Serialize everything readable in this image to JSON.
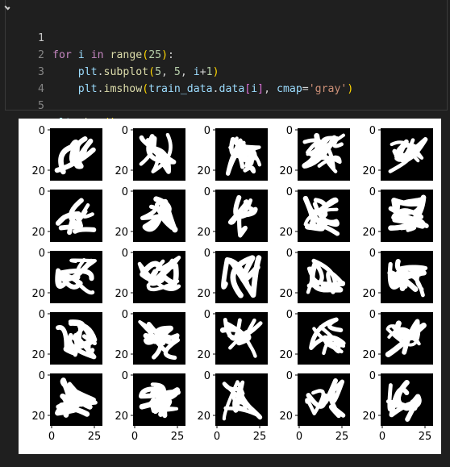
{
  "code_cell": {
    "lines": [
      {
        "number": "1",
        "text": "for i in range(25):"
      },
      {
        "number": "2",
        "text": "    plt.subplot(5, 5, i+1)"
      },
      {
        "number": "3",
        "text": "    plt.imshow(train_data.data[i], cmap='gray')"
      },
      {
        "number": "4",
        "text": ""
      },
      {
        "number": "5",
        "text": "plt.show()"
      }
    ]
  },
  "output_figure": {
    "grid": {
      "rows": 5,
      "cols": 5
    },
    "axis_ticks": {
      "x": [
        "0",
        "25"
      ],
      "y": [
        "0",
        "20"
      ]
    },
    "colormap": "gray",
    "image_background": "#000000",
    "stroke_color": "#ffffff"
  }
}
